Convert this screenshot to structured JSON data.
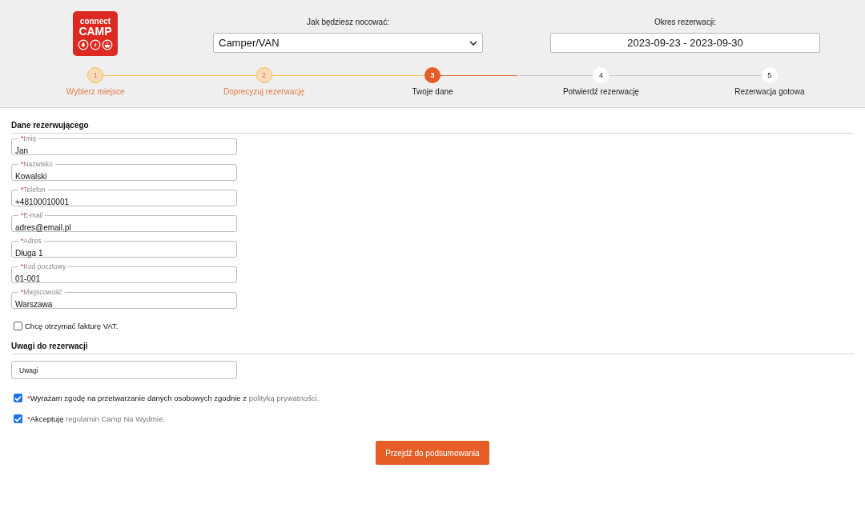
{
  "logo": {
    "line1": "connect",
    "line2": "CAMP"
  },
  "stay": {
    "label": "Jak będziesz nocować:",
    "value": "Camper/VAN"
  },
  "period": {
    "label": "Okres rezerwacji:",
    "value": "2023-09-23 - 2023-09-30"
  },
  "steps": [
    {
      "number": "1",
      "label": "Wybierz miejsce",
      "completed": true,
      "selected": false
    },
    {
      "number": "2",
      "label": "Doprecyzuj rezerwację",
      "completed": true,
      "selected": false
    },
    {
      "number": "3",
      "label": "Twoje dane",
      "completed": false,
      "selected": true
    },
    {
      "number": "4",
      "label": "Potwierdź rezerwację",
      "completed": false,
      "selected": false
    },
    {
      "number": "5",
      "label": "Rezerwacja gotowa",
      "completed": false,
      "selected": false
    }
  ],
  "booker_section": {
    "title": "Dane rezerwującego"
  },
  "fields": [
    {
      "label": "Imię",
      "required_mark": "*",
      "value": "Jan"
    },
    {
      "label": "Nazwisko",
      "required_mark": "*",
      "value": "Kowalski"
    },
    {
      "label": "Telefon",
      "required_mark": "*",
      "value": "+48100010001"
    },
    {
      "label": "E-mail",
      "required_mark": "*",
      "value": "adres@email.pl"
    },
    {
      "label": "Adres",
      "required_mark": "*",
      "value": "Długa 1"
    },
    {
      "label": "Kod pocztowy",
      "required_mark": "*",
      "value": "01-001"
    },
    {
      "label": "Miejscowość",
      "required_mark": "*",
      "value": "Warszawa"
    }
  ],
  "invoice": {
    "label": "Chcę otrzymać fakturę VAT.",
    "checked": false
  },
  "notes_section": {
    "title": "Uwagi do rezerwacji"
  },
  "notes": {
    "placeholder": "Uwagi"
  },
  "consents": [
    {
      "checked": true,
      "required_mark": "*",
      "text": "Wyrażam zgodę na przetwarzanie danych osobowych zgodnie z",
      "link": "polityką prywatności."
    },
    {
      "checked": true,
      "required_mark": "*",
      "text": "Akceptuję",
      "link": "regulamin Camp Na Wydmie."
    }
  ],
  "submit": {
    "label": "Przejdź do podsumowania"
  }
}
